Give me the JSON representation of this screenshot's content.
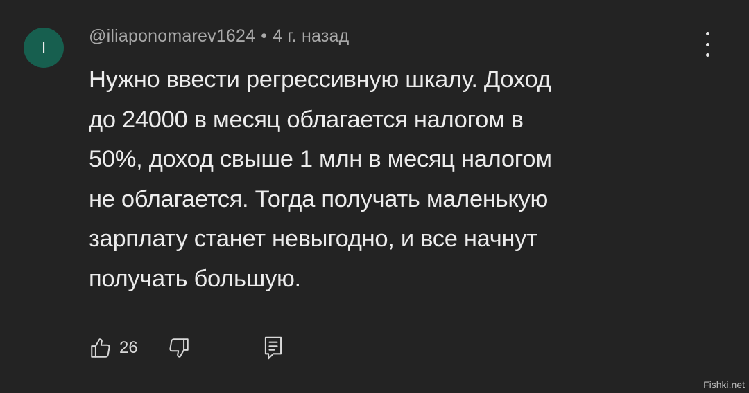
{
  "comment": {
    "avatar_letter": "I",
    "author": "@iliaponomarev1624",
    "separator": "•",
    "time": "4 г. назад",
    "text": "Нужно ввести регрессивную шкалу. Доход\nдо 24000 в месяц облагается налогом в\n50%, доход свыше 1 млн в месяц налогом\nне облагается. Тогда получать маленькую\nзарплату станет невыгодно, и все начнут\nполучать большую.",
    "like_count": "26",
    "avatar_color": "#175f4f"
  },
  "watermark": "Fishki.net",
  "icons": {
    "menu": "more-vertical-icon",
    "like": "thumbs-up-icon",
    "dislike": "thumbs-down-icon",
    "reply": "reply-icon"
  }
}
